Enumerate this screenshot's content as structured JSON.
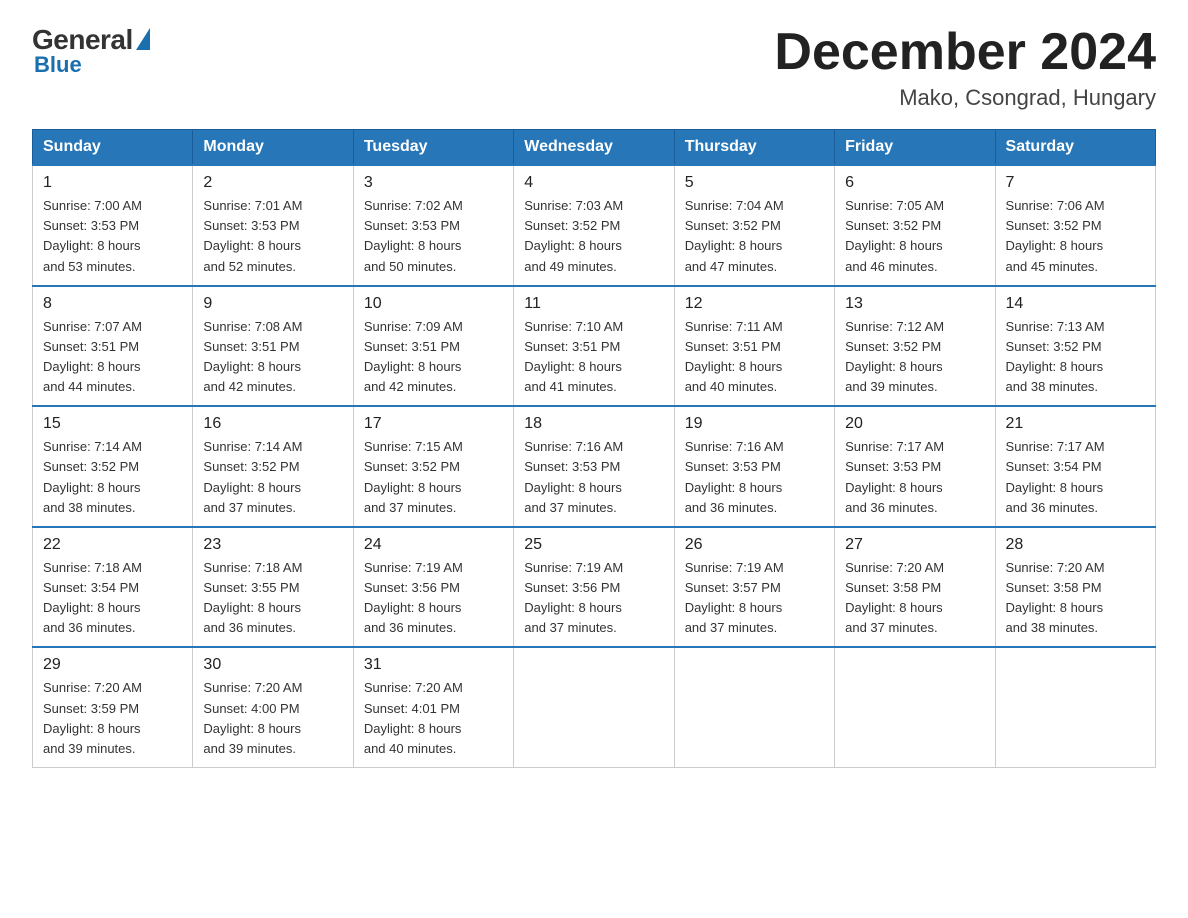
{
  "logo": {
    "general": "General",
    "blue": "Blue"
  },
  "header": {
    "title": "December 2024",
    "subtitle": "Mako, Csongrad, Hungary"
  },
  "days_of_week": [
    "Sunday",
    "Monday",
    "Tuesday",
    "Wednesday",
    "Thursday",
    "Friday",
    "Saturday"
  ],
  "weeks": [
    [
      {
        "day": "1",
        "info": "Sunrise: 7:00 AM\nSunset: 3:53 PM\nDaylight: 8 hours\nand 53 minutes."
      },
      {
        "day": "2",
        "info": "Sunrise: 7:01 AM\nSunset: 3:53 PM\nDaylight: 8 hours\nand 52 minutes."
      },
      {
        "day": "3",
        "info": "Sunrise: 7:02 AM\nSunset: 3:53 PM\nDaylight: 8 hours\nand 50 minutes."
      },
      {
        "day": "4",
        "info": "Sunrise: 7:03 AM\nSunset: 3:52 PM\nDaylight: 8 hours\nand 49 minutes."
      },
      {
        "day": "5",
        "info": "Sunrise: 7:04 AM\nSunset: 3:52 PM\nDaylight: 8 hours\nand 47 minutes."
      },
      {
        "day": "6",
        "info": "Sunrise: 7:05 AM\nSunset: 3:52 PM\nDaylight: 8 hours\nand 46 minutes."
      },
      {
        "day": "7",
        "info": "Sunrise: 7:06 AM\nSunset: 3:52 PM\nDaylight: 8 hours\nand 45 minutes."
      }
    ],
    [
      {
        "day": "8",
        "info": "Sunrise: 7:07 AM\nSunset: 3:51 PM\nDaylight: 8 hours\nand 44 minutes."
      },
      {
        "day": "9",
        "info": "Sunrise: 7:08 AM\nSunset: 3:51 PM\nDaylight: 8 hours\nand 42 minutes."
      },
      {
        "day": "10",
        "info": "Sunrise: 7:09 AM\nSunset: 3:51 PM\nDaylight: 8 hours\nand 42 minutes."
      },
      {
        "day": "11",
        "info": "Sunrise: 7:10 AM\nSunset: 3:51 PM\nDaylight: 8 hours\nand 41 minutes."
      },
      {
        "day": "12",
        "info": "Sunrise: 7:11 AM\nSunset: 3:51 PM\nDaylight: 8 hours\nand 40 minutes."
      },
      {
        "day": "13",
        "info": "Sunrise: 7:12 AM\nSunset: 3:52 PM\nDaylight: 8 hours\nand 39 minutes."
      },
      {
        "day": "14",
        "info": "Sunrise: 7:13 AM\nSunset: 3:52 PM\nDaylight: 8 hours\nand 38 minutes."
      }
    ],
    [
      {
        "day": "15",
        "info": "Sunrise: 7:14 AM\nSunset: 3:52 PM\nDaylight: 8 hours\nand 38 minutes."
      },
      {
        "day": "16",
        "info": "Sunrise: 7:14 AM\nSunset: 3:52 PM\nDaylight: 8 hours\nand 37 minutes."
      },
      {
        "day": "17",
        "info": "Sunrise: 7:15 AM\nSunset: 3:52 PM\nDaylight: 8 hours\nand 37 minutes."
      },
      {
        "day": "18",
        "info": "Sunrise: 7:16 AM\nSunset: 3:53 PM\nDaylight: 8 hours\nand 37 minutes."
      },
      {
        "day": "19",
        "info": "Sunrise: 7:16 AM\nSunset: 3:53 PM\nDaylight: 8 hours\nand 36 minutes."
      },
      {
        "day": "20",
        "info": "Sunrise: 7:17 AM\nSunset: 3:53 PM\nDaylight: 8 hours\nand 36 minutes."
      },
      {
        "day": "21",
        "info": "Sunrise: 7:17 AM\nSunset: 3:54 PM\nDaylight: 8 hours\nand 36 minutes."
      }
    ],
    [
      {
        "day": "22",
        "info": "Sunrise: 7:18 AM\nSunset: 3:54 PM\nDaylight: 8 hours\nand 36 minutes."
      },
      {
        "day": "23",
        "info": "Sunrise: 7:18 AM\nSunset: 3:55 PM\nDaylight: 8 hours\nand 36 minutes."
      },
      {
        "day": "24",
        "info": "Sunrise: 7:19 AM\nSunset: 3:56 PM\nDaylight: 8 hours\nand 36 minutes."
      },
      {
        "day": "25",
        "info": "Sunrise: 7:19 AM\nSunset: 3:56 PM\nDaylight: 8 hours\nand 37 minutes."
      },
      {
        "day": "26",
        "info": "Sunrise: 7:19 AM\nSunset: 3:57 PM\nDaylight: 8 hours\nand 37 minutes."
      },
      {
        "day": "27",
        "info": "Sunrise: 7:20 AM\nSunset: 3:58 PM\nDaylight: 8 hours\nand 37 minutes."
      },
      {
        "day": "28",
        "info": "Sunrise: 7:20 AM\nSunset: 3:58 PM\nDaylight: 8 hours\nand 38 minutes."
      }
    ],
    [
      {
        "day": "29",
        "info": "Sunrise: 7:20 AM\nSunset: 3:59 PM\nDaylight: 8 hours\nand 39 minutes."
      },
      {
        "day": "30",
        "info": "Sunrise: 7:20 AM\nSunset: 4:00 PM\nDaylight: 8 hours\nand 39 minutes."
      },
      {
        "day": "31",
        "info": "Sunrise: 7:20 AM\nSunset: 4:01 PM\nDaylight: 8 hours\nand 40 minutes."
      },
      {
        "day": "",
        "info": ""
      },
      {
        "day": "",
        "info": ""
      },
      {
        "day": "",
        "info": ""
      },
      {
        "day": "",
        "info": ""
      }
    ]
  ]
}
